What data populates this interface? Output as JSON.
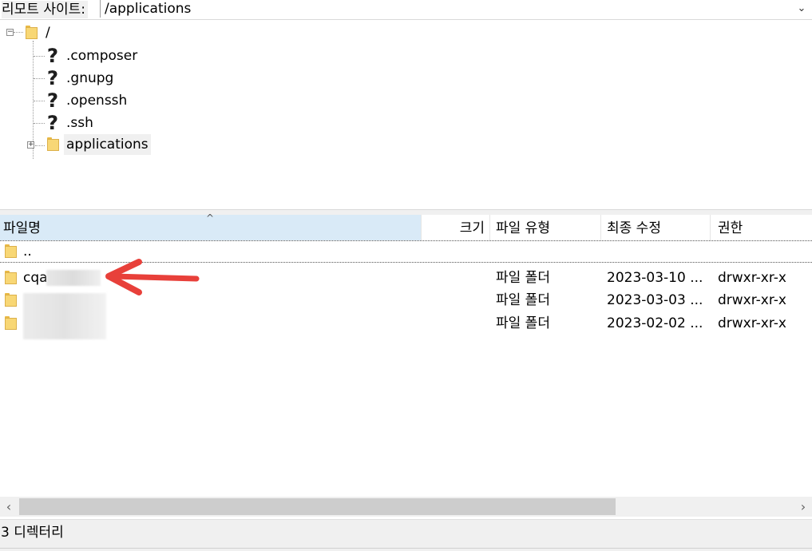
{
  "address_bar": {
    "label": "리모트 사이트:",
    "path": "/applications",
    "dropdown_icon": "chevron-down-icon"
  },
  "tree": {
    "root": {
      "label": "/"
    },
    "children": [
      {
        "label": ".composer",
        "icon": "unknown-question-icon"
      },
      {
        "label": ".gnupg",
        "icon": "unknown-question-icon"
      },
      {
        "label": ".openssh",
        "icon": "unknown-question-icon"
      },
      {
        "label": ".ssh",
        "icon": "unknown-question-icon"
      },
      {
        "label": "applications",
        "icon": "folder-icon",
        "selected": true
      }
    ]
  },
  "list": {
    "columns": {
      "name": "파일명",
      "size": "크기",
      "type": "파일 유형",
      "modified": "최종 수정",
      "permissions": "권한"
    },
    "rows": [
      {
        "name": "..",
        "type": "",
        "modified": "",
        "permissions": ""
      },
      {
        "name": "cqa",
        "type": "파일 폴더",
        "modified": "2023-03-10 ...",
        "permissions": "drwxr-xr-x"
      },
      {
        "name": "",
        "type": "파일 폴더",
        "modified": "2023-03-03 ...",
        "permissions": "drwxr-xr-x"
      },
      {
        "name": "",
        "type": "파일 폴더",
        "modified": "2023-02-02 ...",
        "permissions": "drwxr-xr-x"
      }
    ]
  },
  "scrollbar": {
    "left_icon": "chevron-left-icon",
    "right_icon": "chevron-right-icon"
  },
  "status": {
    "text": "3 디렉터리"
  },
  "colors": {
    "selected_header": "#d9eaf7",
    "folder": "#f8d775",
    "annotation_arrow": "#e8403a"
  }
}
